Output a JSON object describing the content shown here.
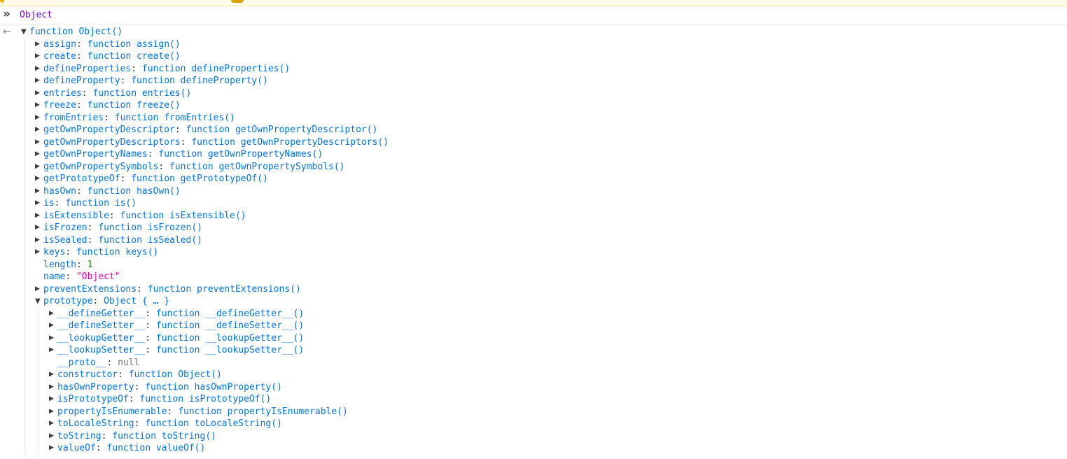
{
  "input": {
    "prompt_icon": "»",
    "expression": "Object"
  },
  "output": {
    "arrow_icon": "←",
    "root_label": "function Object()",
    "properties": [
      {
        "key": "assign",
        "value": "function assign()",
        "type": "fn",
        "expandable": true
      },
      {
        "key": "create",
        "value": "function create()",
        "type": "fn",
        "expandable": true
      },
      {
        "key": "defineProperties",
        "value": "function defineProperties()",
        "type": "fn",
        "expandable": true
      },
      {
        "key": "defineProperty",
        "value": "function defineProperty()",
        "type": "fn",
        "expandable": true
      },
      {
        "key": "entries",
        "value": "function entries()",
        "type": "fn",
        "expandable": true
      },
      {
        "key": "freeze",
        "value": "function freeze()",
        "type": "fn",
        "expandable": true
      },
      {
        "key": "fromEntries",
        "value": "function fromEntries()",
        "type": "fn",
        "expandable": true
      },
      {
        "key": "getOwnPropertyDescriptor",
        "value": "function getOwnPropertyDescriptor()",
        "type": "fn",
        "expandable": true
      },
      {
        "key": "getOwnPropertyDescriptors",
        "value": "function getOwnPropertyDescriptors()",
        "type": "fn",
        "expandable": true
      },
      {
        "key": "getOwnPropertyNames",
        "value": "function getOwnPropertyNames()",
        "type": "fn",
        "expandable": true
      },
      {
        "key": "getOwnPropertySymbols",
        "value": "function getOwnPropertySymbols()",
        "type": "fn",
        "expandable": true
      },
      {
        "key": "getPrototypeOf",
        "value": "function getPrototypeOf()",
        "type": "fn",
        "expandable": true
      },
      {
        "key": "hasOwn",
        "value": "function hasOwn()",
        "type": "fn",
        "expandable": true
      },
      {
        "key": "is",
        "value": "function is()",
        "type": "fn",
        "expandable": true
      },
      {
        "key": "isExtensible",
        "value": "function isExtensible()",
        "type": "fn",
        "expandable": true
      },
      {
        "key": "isFrozen",
        "value": "function isFrozen()",
        "type": "fn",
        "expandable": true
      },
      {
        "key": "isSealed",
        "value": "function isSealed()",
        "type": "fn",
        "expandable": true
      },
      {
        "key": "keys",
        "value": "function keys()",
        "type": "fn",
        "expandable": true
      },
      {
        "key": "length",
        "value": "1",
        "type": "num",
        "expandable": false
      },
      {
        "key": "name",
        "value": "\"Object\"",
        "type": "str",
        "expandable": false
      },
      {
        "key": "preventExtensions",
        "value": "function preventExtensions()",
        "type": "fn",
        "expandable": true
      }
    ],
    "prototype": {
      "key": "prototype",
      "value": "Object { … }",
      "properties": [
        {
          "key": "__defineGetter__",
          "value": "function __defineGetter__()",
          "type": "fn",
          "expandable": true
        },
        {
          "key": "__defineSetter__",
          "value": "function __defineSetter__()",
          "type": "fn",
          "expandable": true
        },
        {
          "key": "__lookupGetter__",
          "value": "function __lookupGetter__()",
          "type": "fn",
          "expandable": true
        },
        {
          "key": "__lookupSetter__",
          "value": "function __lookupSetter__()",
          "type": "fn",
          "expandable": true
        },
        {
          "key": "__proto__",
          "value": "null",
          "type": "nul",
          "expandable": false
        },
        {
          "key": "constructor",
          "value": "function Object()",
          "type": "fn",
          "expandable": true
        },
        {
          "key": "hasOwnProperty",
          "value": "function hasOwnProperty()",
          "type": "fn",
          "expandable": true
        },
        {
          "key": "isPrototypeOf",
          "value": "function isPrototypeOf()",
          "type": "fn",
          "expandable": true
        },
        {
          "key": "propertyIsEnumerable",
          "value": "function propertyIsEnumerable()",
          "type": "fn",
          "expandable": true
        },
        {
          "key": "toLocaleString",
          "value": "function toLocaleString()",
          "type": "fn",
          "expandable": true
        },
        {
          "key": "toString",
          "value": "function toString()",
          "type": "fn",
          "expandable": true
        },
        {
          "key": "valueOf",
          "value": "function valueOf()",
          "type": "fn",
          "expandable": true
        }
      ]
    },
    "colors": {
      "key": "#0074e8",
      "number": "#058b00",
      "string": "#dd00a9",
      "null": "#737373",
      "input": "#8000d7"
    }
  }
}
